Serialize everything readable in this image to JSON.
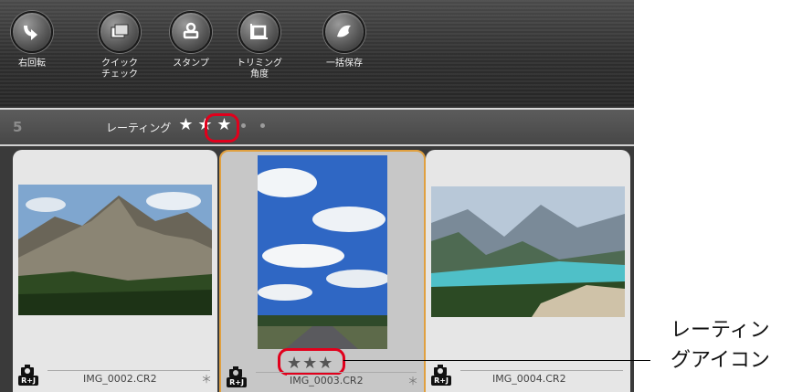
{
  "toolbar": {
    "buttons": [
      {
        "label": "右回転",
        "icon": "rotate-right-icon"
      },
      {
        "label": "クイック\nチェック",
        "icon": "quick-check-icon"
      },
      {
        "label": "スタンプ",
        "icon": "stamp-icon"
      },
      {
        "label": "トリミング\n角度",
        "icon": "trim-angle-icon"
      },
      {
        "label": "一括保存",
        "icon": "batch-save-icon"
      }
    ]
  },
  "rating_bar": {
    "number": "5",
    "label": "レーティング",
    "stars_set": 3,
    "star_glyph": "★",
    "highlight_color": "#e1001c"
  },
  "thumbnails": [
    {
      "filename": "IMG_0002.CR2",
      "marker": "＊",
      "badge": "R+J"
    },
    {
      "filename": "IMG_0003.CR2",
      "marker": "＊",
      "badge": "R+J",
      "stars": "★★★",
      "selected": true
    },
    {
      "filename": "IMG_0004.CR2",
      "marker": "",
      "badge": "R+J"
    }
  ],
  "callout": {
    "text": "レーティン\nグアイコン"
  }
}
